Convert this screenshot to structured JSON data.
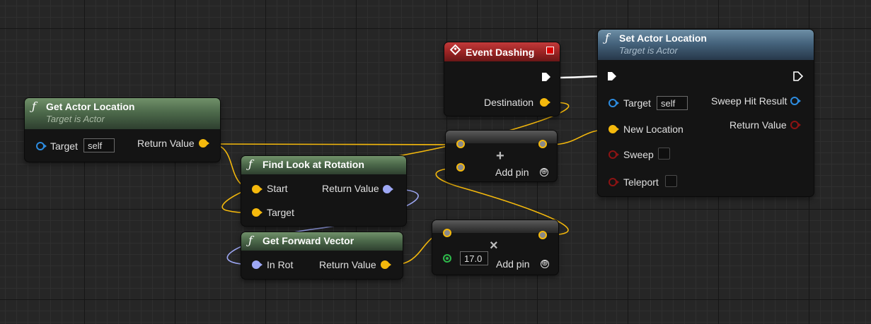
{
  "colors": {
    "vector_pin": "#f5b90c",
    "rotator_pin": "#9ea8f5",
    "object_pin": "#2d8ce0",
    "struct_pin": "#8c1313",
    "float_pin": "#2db84a",
    "exec_wire": "#ffffff"
  },
  "get_actor_location": {
    "icon": "function-icon",
    "title": "Get Actor Location",
    "subtitle": "Target is Actor",
    "target_label": "Target",
    "target_value": "self",
    "return_label": "Return Value"
  },
  "find_look_at_rotation": {
    "icon": "function-icon",
    "title": "Find Look at Rotation",
    "start_label": "Start",
    "target_label": "Target",
    "return_label": "Return Value"
  },
  "get_forward_vector": {
    "icon": "function-icon",
    "title": "Get Forward Vector",
    "in_rot_label": "In Rot",
    "return_label": "Return Value"
  },
  "event_dashing": {
    "icon": "event-icon",
    "title": "Event Dashing",
    "destination_label": "Destination"
  },
  "add_node": {
    "operator": "+",
    "add_pin_label": "Add pin",
    "add_pin_icon": "⊕"
  },
  "multiply_node": {
    "operator": "×",
    "float_value": "17.0",
    "add_pin_label": "Add pin",
    "add_pin_icon": "⊕"
  },
  "set_actor_location": {
    "icon": "function-icon",
    "title": "Set Actor Location",
    "subtitle": "Target is Actor",
    "target_label": "Target",
    "target_value": "self",
    "new_location_label": "New Location",
    "sweep_label": "Sweep",
    "teleport_label": "Teleport",
    "sweep_hit_label": "Sweep Hit Result",
    "return_label": "Return Value"
  }
}
